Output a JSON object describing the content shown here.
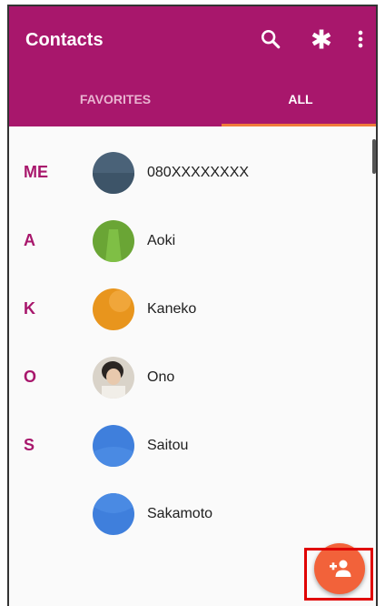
{
  "app": {
    "title": "Contacts"
  },
  "toolbar": {
    "search_icon": "search-icon",
    "settings_icon": "asterisk-icon",
    "more_icon": "more-vert-icon"
  },
  "tabs": [
    {
      "label": "FAVORITES",
      "selected": false
    },
    {
      "label": "ALL",
      "selected": true
    }
  ],
  "contacts": [
    {
      "letter": "ME",
      "name": "080XXXXXXXX",
      "avatar_color": "#4a6278"
    },
    {
      "letter": "A",
      "name": "Aoki",
      "avatar_color": "#6aa535"
    },
    {
      "letter": "K",
      "name": "Kaneko",
      "avatar_color": "#e8951d"
    },
    {
      "letter": "O",
      "name": "Ono",
      "avatar_color": "#d9d3c9"
    },
    {
      "letter": "S",
      "name": "Saitou",
      "avatar_color": "#3f7fdc"
    },
    {
      "letter": "",
      "name": "Sakamoto",
      "avatar_color": "#3f7fdc"
    }
  ],
  "fab": {
    "icon": "add-contact-icon",
    "color": "#f2623a"
  },
  "colors": {
    "accent": "#a8176c",
    "tab_indicator": "#f07a3a",
    "highlight": "#e00000"
  }
}
